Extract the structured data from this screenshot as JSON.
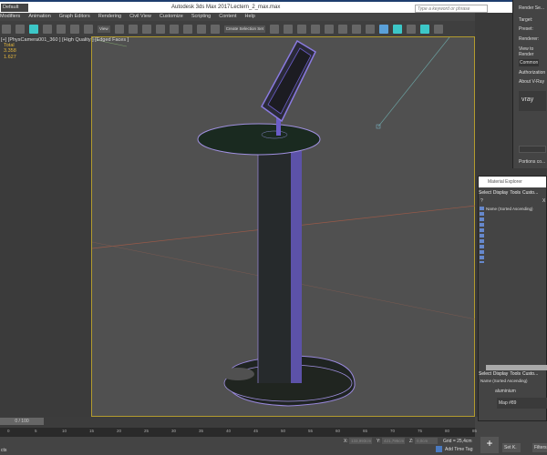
{
  "titlebar": {
    "workspace": "Default",
    "app_title": "Autodesk 3ds Max 2017",
    "file": "Lectern_2_max.max",
    "search_placeholder": "Type a keyword or phrase"
  },
  "menu": [
    "Modifiers",
    "Animation",
    "Graph Editors",
    "Rendering",
    "Civil View",
    "Customize",
    "Scripting",
    "Content",
    "Help"
  ],
  "toolbar": {
    "view_select": "View",
    "selection_set": "Create Selection Set"
  },
  "viewport": {
    "label": "[+] [PhysCamera001_360 ] [High Quality ] [Edged Faces ]",
    "stats": [
      "Total",
      "3.358",
      "1.627"
    ]
  },
  "render_setup": {
    "title": "Render Se...",
    "target": "Target:",
    "preset": "Preset:",
    "renderer": "Renderer:",
    "view": "View to Render",
    "tab_common": "Common",
    "tab_vray": "V-Ray",
    "authorization": "Authorization",
    "about": "About V-Ray",
    "logo": "vray",
    "portions": "Portions co..."
  },
  "material_explorer": {
    "title": "Material Explorer",
    "menu": [
      "Select",
      "Display",
      "Tools",
      "Custo..."
    ],
    "help": "?",
    "close": "X",
    "header": "Name (Sorted Ascending)",
    "menu2": [
      "Select",
      "Display",
      "Tools",
      "Custo..."
    ],
    "header2": "Name (Sorted Ascending)",
    "items": [
      "aluminium",
      "Map #89"
    ]
  },
  "timeline": {
    "frame": "0 / 100",
    "ticks": [
      "0",
      "5",
      "10",
      "15",
      "20",
      "25",
      "30",
      "35",
      "40",
      "45",
      "50",
      "55",
      "60",
      "65",
      "70",
      "75",
      "80",
      "85"
    ]
  },
  "status": {
    "x_label": "X:",
    "x": "133,993cm",
    "y_label": "Y:",
    "y": "421,795cm",
    "z_label": "Z:",
    "z": "0,0cm",
    "grid": "Grid = 25,4cm",
    "add_time_tag": "Add Time Tag",
    "set_key": "Set K.",
    "filters": "Filters...",
    "left": "cts"
  }
}
